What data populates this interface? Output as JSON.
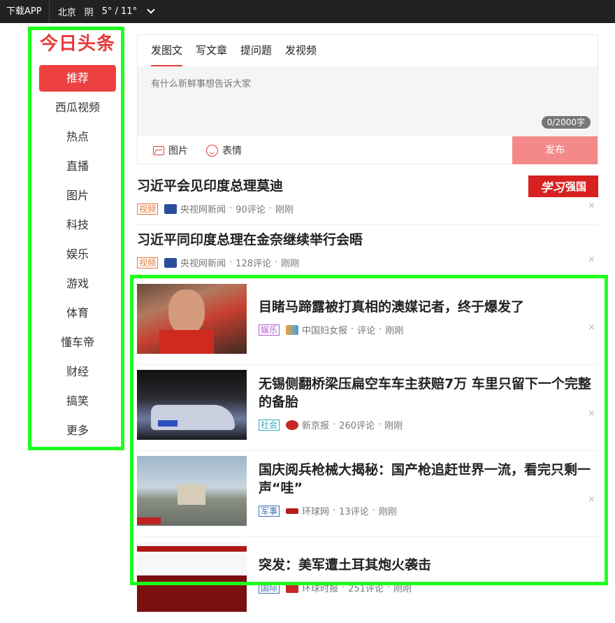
{
  "topbar": {
    "download": "下载APP",
    "city": "北京",
    "weather": "阴",
    "temp": "5° / 11°"
  },
  "sidebar": {
    "logo": "今日头条",
    "items": [
      {
        "label": "推荐"
      },
      {
        "label": "西瓜视频"
      },
      {
        "label": "热点"
      },
      {
        "label": "直播"
      },
      {
        "label": "图片"
      },
      {
        "label": "科技"
      },
      {
        "label": "娱乐"
      },
      {
        "label": "游戏"
      },
      {
        "label": "体育"
      },
      {
        "label": "懂车帝"
      },
      {
        "label": "财经"
      },
      {
        "label": "搞笑"
      },
      {
        "label": "更多"
      }
    ]
  },
  "publisher": {
    "tabs": [
      "发图文",
      "写文章",
      "提问题",
      "发视频"
    ],
    "placeholder": "有什么新鲜事想告诉大家",
    "count": "0/2000字",
    "image_label": "图片",
    "emoji_label": "表情",
    "publish": "发布"
  },
  "ad": {
    "text": "强国",
    "script": "学习"
  },
  "feed": [
    {
      "title": "习近平会见印度总理莫迪",
      "tag": "视频",
      "source": "央视网新闻",
      "comments": "90评论",
      "time": "刚刚"
    },
    {
      "title": "习近平同印度总理在金奈继续举行会晤",
      "tag": "视频",
      "source": "央视网新闻",
      "comments": "128评论",
      "time": "刚刚"
    },
    {
      "title": "目睹马蹄露被打真相的澳媒记者，终于爆发了",
      "tag": "娱乐",
      "source": "中国妇女报",
      "comments": "评论",
      "time": "刚刚"
    },
    {
      "title": "无锡侧翻桥梁压扁空车车主获赔7万 车里只留下一个完整的备胎",
      "tag": "社会",
      "source": "新京报",
      "comments": "260评论",
      "time": "刚刚"
    },
    {
      "title": "国庆阅兵枪械大揭秘：国产枪追赶世界一流，看完只剩一声“哇”",
      "tag": "军事",
      "source": "环球网",
      "comments": "13评论",
      "time": "刚刚"
    },
    {
      "title": "突发：美军遭土耳其炮火袭击",
      "tag": "国际",
      "source": "环球时报",
      "comments": "251评论",
      "time": "刚刚"
    }
  ],
  "close_glyph": "×",
  "sep": "·"
}
